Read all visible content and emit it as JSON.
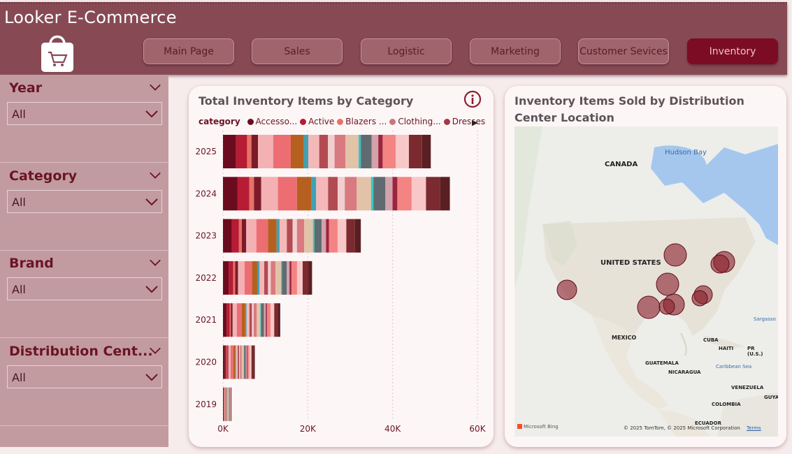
{
  "app": {
    "title": "Looker E-Commerce"
  },
  "nav": [
    {
      "label": "Main Page",
      "active": false
    },
    {
      "label": "Sales",
      "active": false
    },
    {
      "label": "Logistic",
      "active": false
    },
    {
      "label": "Marketing",
      "active": false
    },
    {
      "label": "Customer Sevices",
      "active": false
    },
    {
      "label": "Inventory",
      "active": true
    }
  ],
  "filters": [
    {
      "title": "Year",
      "value": "All"
    },
    {
      "title": "Category",
      "value": "All"
    },
    {
      "title": "Brand",
      "value": "All"
    },
    {
      "title": "Distribution Cent...",
      "value": "All"
    }
  ],
  "chart_card": {
    "title": "Total Inventory Items by Category",
    "legend_title": "category",
    "legend": [
      {
        "label": "Accesso...",
        "color": "#6b0c1e"
      },
      {
        "label": "Active",
        "color": "#b71c34"
      },
      {
        "label": "Blazers ...",
        "color": "#e57366"
      },
      {
        "label": "Clothing...",
        "color": "#c4787e"
      },
      {
        "label": "Dresses",
        "color": "#a33a45"
      }
    ]
  },
  "chart_data": {
    "type": "bar",
    "orientation": "horizontal",
    "stacked": true,
    "title": "Total Inventory Items by Category",
    "categories": [
      "2025",
      "2024",
      "2023",
      "2022",
      "2021",
      "2020",
      "2019"
    ],
    "totals": [
      49000,
      53500,
      32500,
      21000,
      13500,
      7500,
      2000
    ],
    "x_ticks": [
      "0K",
      "20K",
      "40K",
      "60K"
    ],
    "xlim": [
      0,
      60000
    ],
    "legend_title": "category",
    "series_names_visible": [
      "Accesso...",
      "Active",
      "Blazers ...",
      "Clothing...",
      "Dresses"
    ],
    "segment_palette": [
      "#6b0c1e",
      "#b71c34",
      "#e57366",
      "#7c1a2a",
      "#f3b1b3",
      "#ec6e73",
      "#b5601e",
      "#3fa2b5",
      "#f4b8b8",
      "#b24a52",
      "#f0cfcf",
      "#d97a80",
      "#e2c3a8",
      "#3cc4c4",
      "#5f6b70",
      "#d4a2aa",
      "#9a2540",
      "#f48484",
      "#f8c8c8",
      "#7b2a30",
      "#5a1f22"
    ],
    "grid": true
  },
  "map_card": {
    "title": "Inventory Items Sold by Distribution Center Location",
    "labels": {
      "canada": "CANADA",
      "usa": "UNITED STATES",
      "mexico": "MEXICO",
      "hudson": "Hudson Bay",
      "cuba": "CUBA",
      "haiti": "HAITI",
      "pr": "PR (U.S.)",
      "guatemala": "GUATEMALA",
      "nicaragua": "NICARAGUA",
      "caribbean": "Caribbean Sea",
      "venezuela": "VENEZUELA",
      "colombia": "COLOMBIA",
      "ecuador": "ECUADOR",
      "sargasso": "Sargasso",
      "guyana": "GUYA"
    },
    "bing": "Microsoft Bing",
    "copyright": "© 2025 TomTom, © 2025 Microsoft Corporation",
    "terms": "Terms"
  }
}
